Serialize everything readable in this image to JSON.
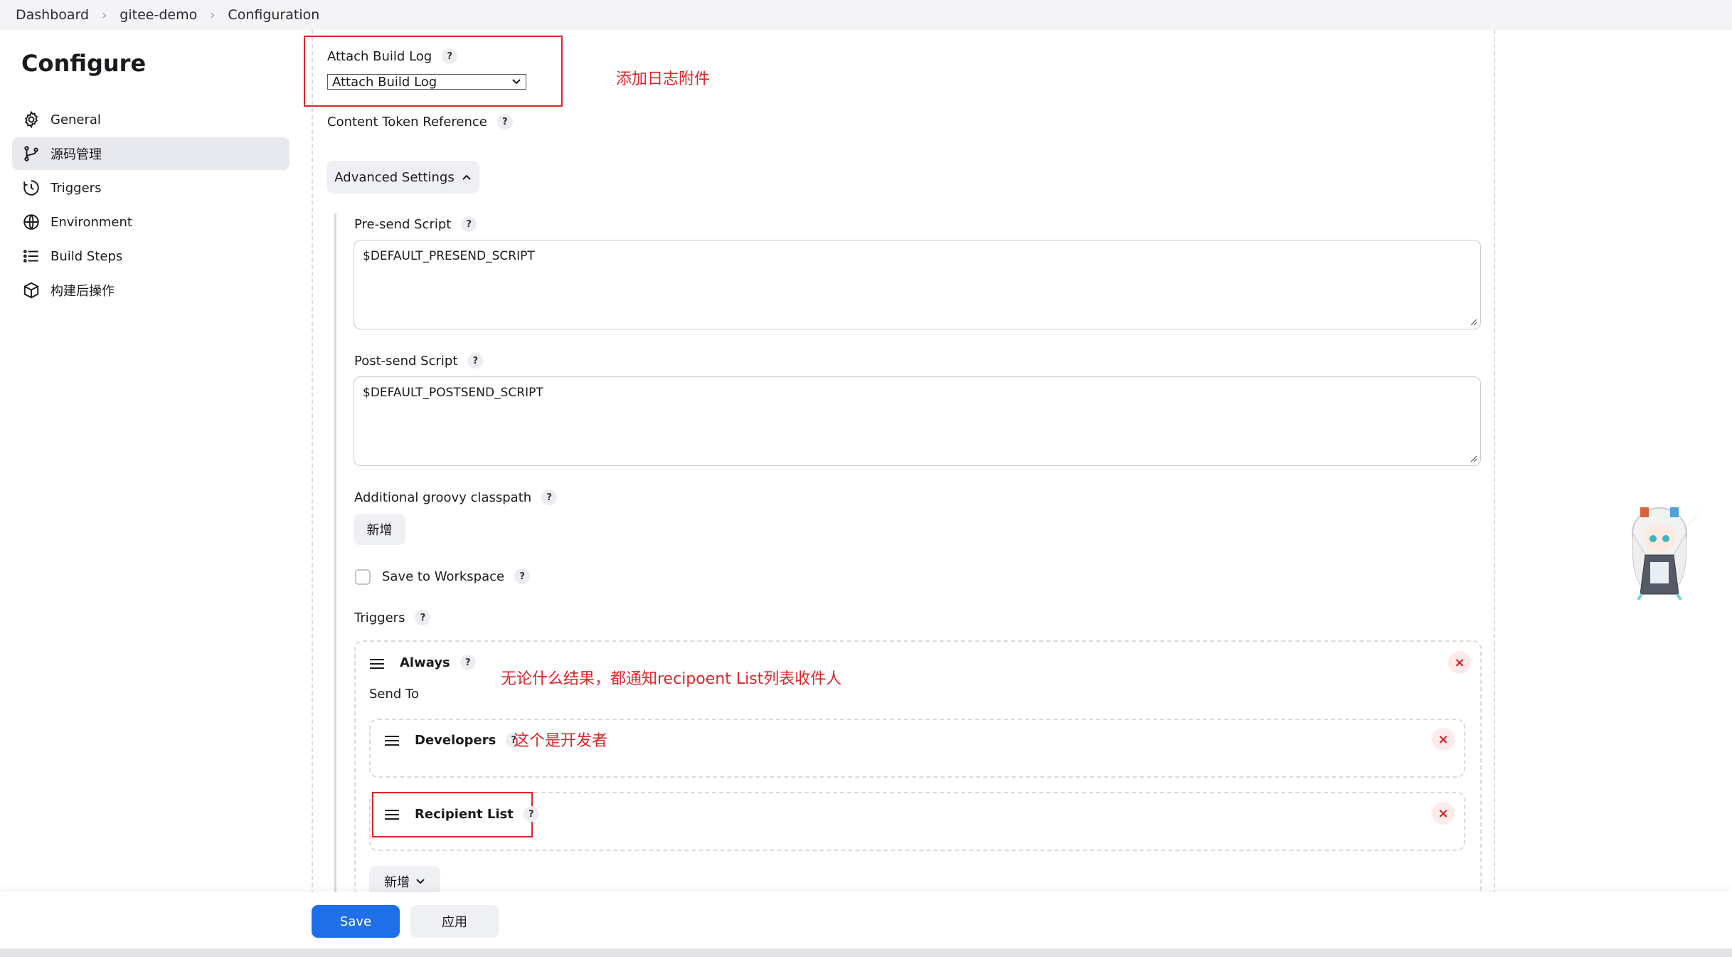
{
  "breadcrumb": [
    "Dashboard",
    "gitee-demo",
    "Configuration"
  ],
  "sidebar": {
    "title": "Configure",
    "items": [
      {
        "label": "General",
        "icon": "gear-icon"
      },
      {
        "label": "源码管理",
        "icon": "branch-icon"
      },
      {
        "label": "Triggers",
        "icon": "clock-icon"
      },
      {
        "label": "Environment",
        "icon": "globe-icon"
      },
      {
        "label": "Build Steps",
        "icon": "list-icon"
      },
      {
        "label": "构建后操作",
        "icon": "cube-icon"
      }
    ]
  },
  "form": {
    "attach_build_log_label": "Attach Build Log",
    "attach_build_log_value": "Attach Build Log",
    "content_token_label": "Content Token Reference",
    "advanced_settings": "Advanced Settings",
    "presend_label": "Pre-send Script",
    "presend_value": "$DEFAULT_PRESEND_SCRIPT",
    "postsend_label": "Post-send Script",
    "postsend_value": "$DEFAULT_POSTSEND_SCRIPT",
    "groovy_label": "Additional groovy classpath",
    "add_button": "新增",
    "save_workspace_label": "Save to Workspace",
    "triggers_label": "Triggers",
    "always_label": "Always",
    "send_to_label": "Send To",
    "developers_label": "Developers",
    "recipient_list_label": "Recipient List",
    "add_dropdown_label": "新增"
  },
  "annotations": {
    "attach_log": "添加日志附件",
    "always": "无论什么结果，都通知recipoent List列表收件人",
    "developers": "这个是开发者"
  },
  "footer": {
    "save": "Save",
    "apply": "应用"
  },
  "help_mark": "?",
  "close_mark": "×",
  "colors": {
    "accent": "#1e6fe8",
    "annotation": "#e0242a"
  }
}
